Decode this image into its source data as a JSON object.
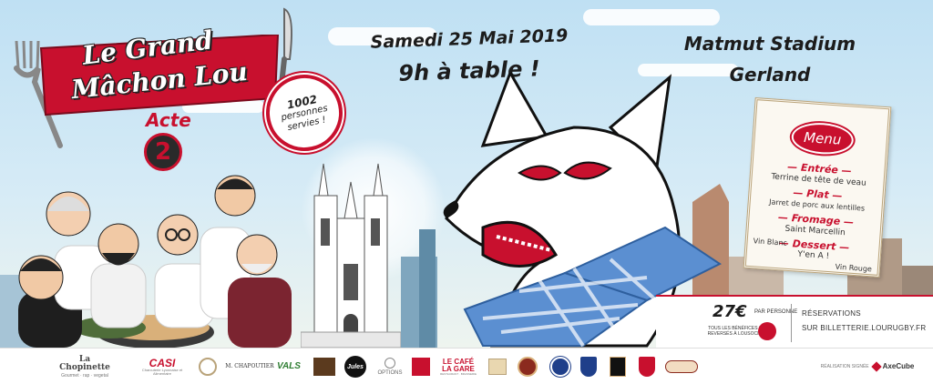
{
  "title": {
    "line1": "Le Grand",
    "line2": "Mâchon Lou"
  },
  "act": {
    "label": "Acte",
    "number": "2"
  },
  "stamp": {
    "count": "1002",
    "line1": "personnes",
    "line2": "servies !"
  },
  "event": {
    "date": "Samedi 25 Mai 2019",
    "time": "9h à table !"
  },
  "venue": {
    "line1": "Matmut Stadium",
    "line2": "Gerland"
  },
  "menu": {
    "title": "Menu",
    "sections": [
      {
        "head": "Entrée",
        "item": "Terrine de tête de veau"
      },
      {
        "head": "Plat",
        "item": "Jarret de porc aux lentilles"
      },
      {
        "head": "Fromage",
        "item": "Saint Marcellin"
      },
      {
        "head": "Dessert",
        "item": "Y'en A !"
      }
    ],
    "wine_white": "Vin Blanc",
    "wine_red": "Vin Rouge"
  },
  "price": {
    "value": "27€",
    "per": "PAR PERSONNE",
    "note": "TOUS LES BÉNÉFICES SONT REVERSÉS À LOUSOCIATION"
  },
  "booking": {
    "label": "RÉSERVATIONS",
    "url": "SUR BILLETTERIE.LOURUGBY.FR"
  },
  "sponsors": {
    "chopinette": "La Chopinette",
    "chopinette_sub": "Gourmet · rap · vegetal",
    "casi": "CASI",
    "casi_sub": "Charcuterie Lyonnaise et Alimentaire",
    "chapoutier": "M. CHAPOUTIER",
    "vals": "VALS",
    "jules": "Jules",
    "options": "OPTIONS",
    "cafe": "LE CAFÉ",
    "gare": "LA GARE",
    "lagare_sub": "RESTAURANT · BRASSERIE",
    "credit_label": "RÉALISATION SIGNÉE",
    "credit_brand": "AxeCube"
  },
  "colors": {
    "red": "#c8102e",
    "sky": "#cfe6f3",
    "blue_check": "#3d7cc4",
    "dark": "#1c1c1c"
  }
}
